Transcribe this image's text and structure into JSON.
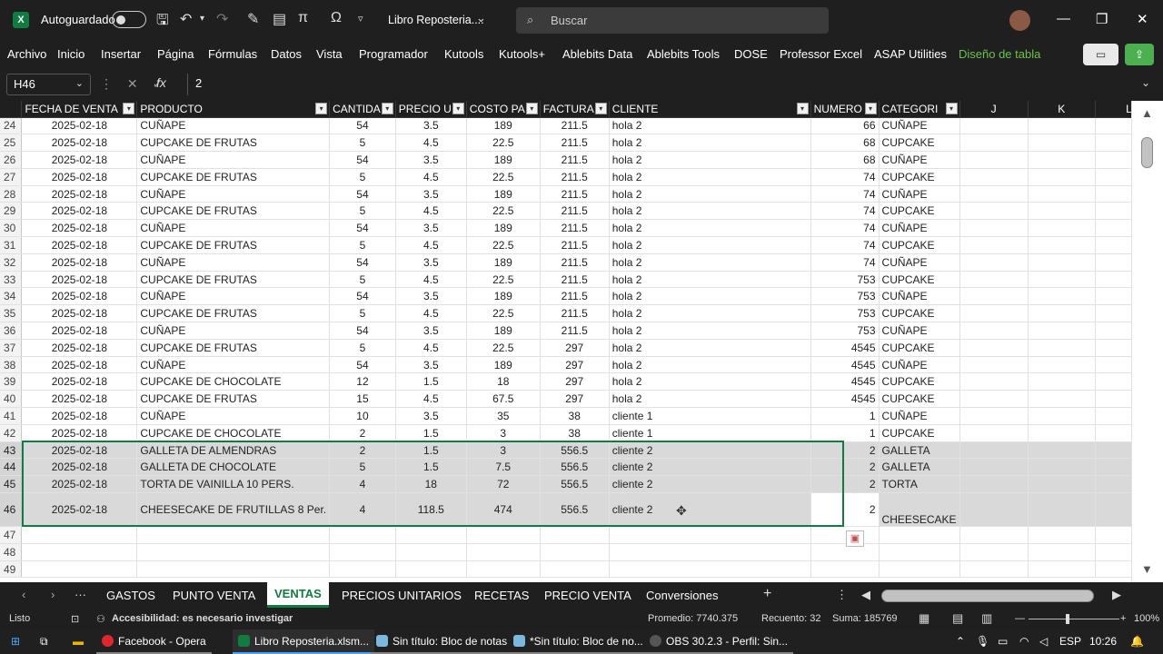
{
  "titlebar": {
    "autosave_label": "Autoguardado",
    "doc_title": "Libro Reposteria....",
    "search_placeholder": "Buscar"
  },
  "ribbon": {
    "tabs": [
      "Archivo",
      "Inicio",
      "Insertar",
      "Página",
      "Fórmulas",
      "Datos",
      "Vista",
      "Programador",
      "Kutools",
      "Kutools+",
      "Ablebits Data",
      "Ablebits Tools",
      "DOSE",
      "Professor Excel",
      "ASAP Utilities",
      "Diseño de tabla"
    ]
  },
  "formula_bar": {
    "name_box": "H46",
    "formula": "2"
  },
  "sheet": {
    "columns": [
      "FECHA DE VENTA",
      "PRODUCTO",
      "CANTIDA",
      "PRECIO U",
      "COSTO PA",
      "FACTURA",
      "CLIENTE",
      "NUMERO",
      "CATEGORI",
      "J",
      "K",
      "L"
    ],
    "rows": [
      [
        "24",
        "2025-02-18",
        "CUÑAPE",
        "54",
        "3.5",
        "189",
        "211.5",
        "hola 2",
        "66",
        "CUÑAPE"
      ],
      [
        "25",
        "2025-02-18",
        "CUPCAKE DE FRUTAS",
        "5",
        "4.5",
        "22.5",
        "211.5",
        "hola 2",
        "68",
        "CUPCAKE"
      ],
      [
        "26",
        "2025-02-18",
        "CUÑAPE",
        "54",
        "3.5",
        "189",
        "211.5",
        "hola 2",
        "68",
        "CUÑAPE"
      ],
      [
        "27",
        "2025-02-18",
        "CUPCAKE DE FRUTAS",
        "5",
        "4.5",
        "22.5",
        "211.5",
        "hola 2",
        "74",
        "CUPCAKE"
      ],
      [
        "28",
        "2025-02-18",
        "CUÑAPE",
        "54",
        "3.5",
        "189",
        "211.5",
        "hola 2",
        "74",
        "CUÑAPE"
      ],
      [
        "29",
        "2025-02-18",
        "CUPCAKE DE FRUTAS",
        "5",
        "4.5",
        "22.5",
        "211.5",
        "hola 2",
        "74",
        "CUPCAKE"
      ],
      [
        "30",
        "2025-02-18",
        "CUÑAPE",
        "54",
        "3.5",
        "189",
        "211.5",
        "hola 2",
        "74",
        "CUÑAPE"
      ],
      [
        "31",
        "2025-02-18",
        "CUPCAKE DE FRUTAS",
        "5",
        "4.5",
        "22.5",
        "211.5",
        "hola 2",
        "74",
        "CUPCAKE"
      ],
      [
        "32",
        "2025-02-18",
        "CUÑAPE",
        "54",
        "3.5",
        "189",
        "211.5",
        "hola 2",
        "74",
        "CUÑAPE"
      ],
      [
        "33",
        "2025-02-18",
        "CUPCAKE DE FRUTAS",
        "5",
        "4.5",
        "22.5",
        "211.5",
        "hola 2",
        "753",
        "CUPCAKE"
      ],
      [
        "34",
        "2025-02-18",
        "CUÑAPE",
        "54",
        "3.5",
        "189",
        "211.5",
        "hola 2",
        "753",
        "CUÑAPE"
      ],
      [
        "35",
        "2025-02-18",
        "CUPCAKE DE FRUTAS",
        "5",
        "4.5",
        "22.5",
        "211.5",
        "hola 2",
        "753",
        "CUPCAKE"
      ],
      [
        "36",
        "2025-02-18",
        "CUÑAPE",
        "54",
        "3.5",
        "189",
        "211.5",
        "hola 2",
        "753",
        "CUÑAPE"
      ],
      [
        "37",
        "2025-02-18",
        "CUPCAKE DE FRUTAS",
        "5",
        "4.5",
        "22.5",
        "297",
        "hola 2",
        "4545",
        "CUPCAKE"
      ],
      [
        "38",
        "2025-02-18",
        "CUÑAPE",
        "54",
        "3.5",
        "189",
        "297",
        "hola 2",
        "4545",
        "CUÑAPE"
      ],
      [
        "39",
        "2025-02-18",
        "CUPCAKE DE CHOCOLATE",
        "12",
        "1.5",
        "18",
        "297",
        "hola 2",
        "4545",
        "CUPCAKE"
      ],
      [
        "40",
        "2025-02-18",
        "CUPCAKE DE FRUTAS",
        "15",
        "4.5",
        "67.5",
        "297",
        "hola 2",
        "4545",
        "CUPCAKE"
      ],
      [
        "41",
        "2025-02-18",
        "CUÑAPE",
        "10",
        "3.5",
        "35",
        "38",
        "cliente 1",
        "1",
        "CUÑAPE"
      ],
      [
        "42",
        "2025-02-18",
        "CUPCAKE DE CHOCOLATE",
        "2",
        "1.5",
        "3",
        "38",
        "cliente 1",
        "1",
        "CUPCAKE"
      ],
      [
        "43",
        "2025-02-18",
        "GALLETA DE ALMENDRAS",
        "2",
        "1.5",
        "3",
        "556.5",
        "cliente 2",
        "2",
        "GALLETA"
      ],
      [
        "44",
        "2025-02-18",
        "GALLETA DE CHOCOLATE",
        "5",
        "1.5",
        "7.5",
        "556.5",
        "cliente 2",
        "2",
        "GALLETA"
      ],
      [
        "45",
        "2025-02-18",
        "TORTA DE VAINILLA 10 PERS.",
        "4",
        "18",
        "72",
        "556.5",
        "cliente 2",
        "2",
        "TORTA"
      ],
      [
        "46",
        "2025-02-18",
        "CHEESECAKE DE FRUTILLAS 8 Per.",
        "4",
        "118.5",
        "474",
        "556.5",
        "cliente 2",
        "2",
        "CHEESECAKE"
      ],
      [
        "47",
        "",
        "",
        "",
        "",
        "",
        "",
        "",
        "",
        ""
      ],
      [
        "48",
        "",
        "",
        "",
        "",
        "",
        "",
        "",
        "",
        ""
      ],
      [
        "49",
        "",
        "",
        "",
        "",
        "",
        "",
        "",
        "",
        ""
      ]
    ]
  },
  "sheet_tabs": {
    "tabs": [
      "GASTOS",
      "PUNTO VENTA",
      "VENTAS",
      "PRECIOS UNITARIOS",
      "RECETAS",
      "PRECIO VENTA",
      "Conversiones"
    ],
    "active": "VENTAS"
  },
  "statusbar": {
    "mode": "Listo",
    "accessibility": "Accesibilidad: es necesario investigar",
    "average": "Promedio: 7740.375",
    "count": "Recuento: 32",
    "sum": "Suma: 185769",
    "zoom": "100%"
  },
  "taskbar": {
    "items": [
      "Facebook - Opera",
      "Libro Reposteria.xlsm...",
      "Sin título: Bloc de notas",
      "*Sin título: Bloc de no...",
      "OBS 30.2.3 - Perfil: Sin..."
    ],
    "lang": "ESP",
    "time": "10:26"
  },
  "colors": {
    "accent": "#107c41",
    "selection": "#d9d9d9"
  }
}
